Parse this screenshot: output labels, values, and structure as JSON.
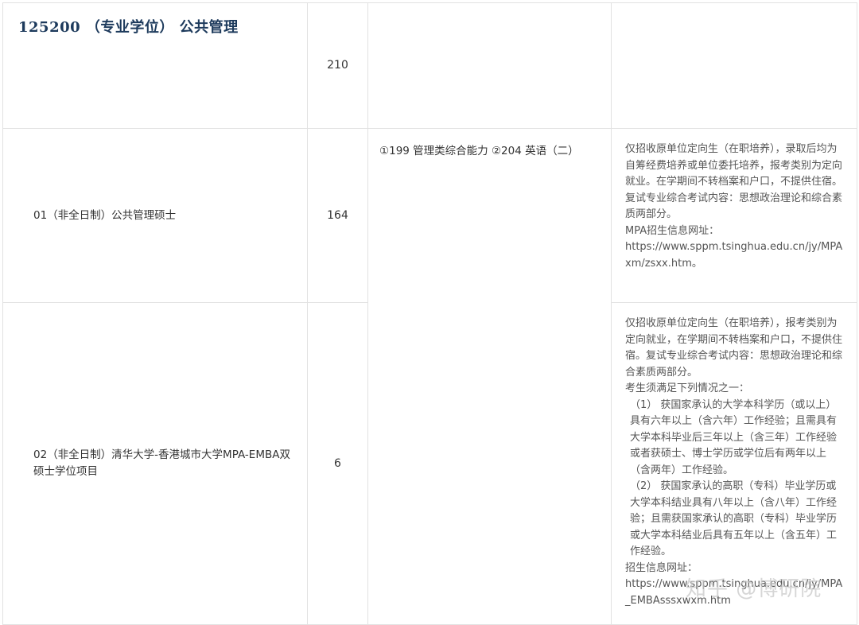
{
  "table": {
    "major": {
      "title": "125200 （专业学位） 公共管理",
      "count": "210"
    },
    "rows": [
      {
        "name": "01（非全日制）公共管理硕士",
        "count": "164",
        "exam": "①199 管理类综合能力 ②204 英语（二）",
        "notes": [
          "仅招收原单位定向生（在职培养），录取后均为自筹经费培养或单位委托培养，报考类别为定向就业。在学期间不转档案和户口，不提供住宿。",
          "复试专业综合考试内容：思想政治理论和综合素质两部分。",
          "MPA招生信息网址：",
          "https://www.sppm.tsinghua.edu.cn/jy/MPAxm/zsxx.htm。"
        ]
      },
      {
        "name": "02（非全日制）清华大学-香港城市大学MPA-EMBA双硕士学位项目",
        "count": "6",
        "notes": [
          "仅招收原单位定向生（在职培养），报考类别为定向就业，在学期间不转档案和户口，不提供住宿。复试专业综合考试内容：思想政治理论和综合素质两部分。",
          "考生须满足下列情况之一：",
          "（1） 获国家承认的大学本科学历（或以上）具有六年以上（含六年）工作经验；且需具有大学本科毕业后三年以上（含三年）工作经验或者获硕士、博士学历或学位后有两年以上（含两年）工作经验。",
          "（2） 获国家承认的高职（专科）毕业学历或大学本科结业具有八年以上（含八年）工作经验；且需获国家承认的高职（专科）毕业学历或大学本科结业后具有五年以上（含五年）工作经验。",
          "招生信息网址：",
          "https://www.sppm.tsinghua.edu.cn/jy/MPA_EMBAsssxwxm.htm"
        ]
      }
    ]
  },
  "watermark": "知乎 @博研院"
}
